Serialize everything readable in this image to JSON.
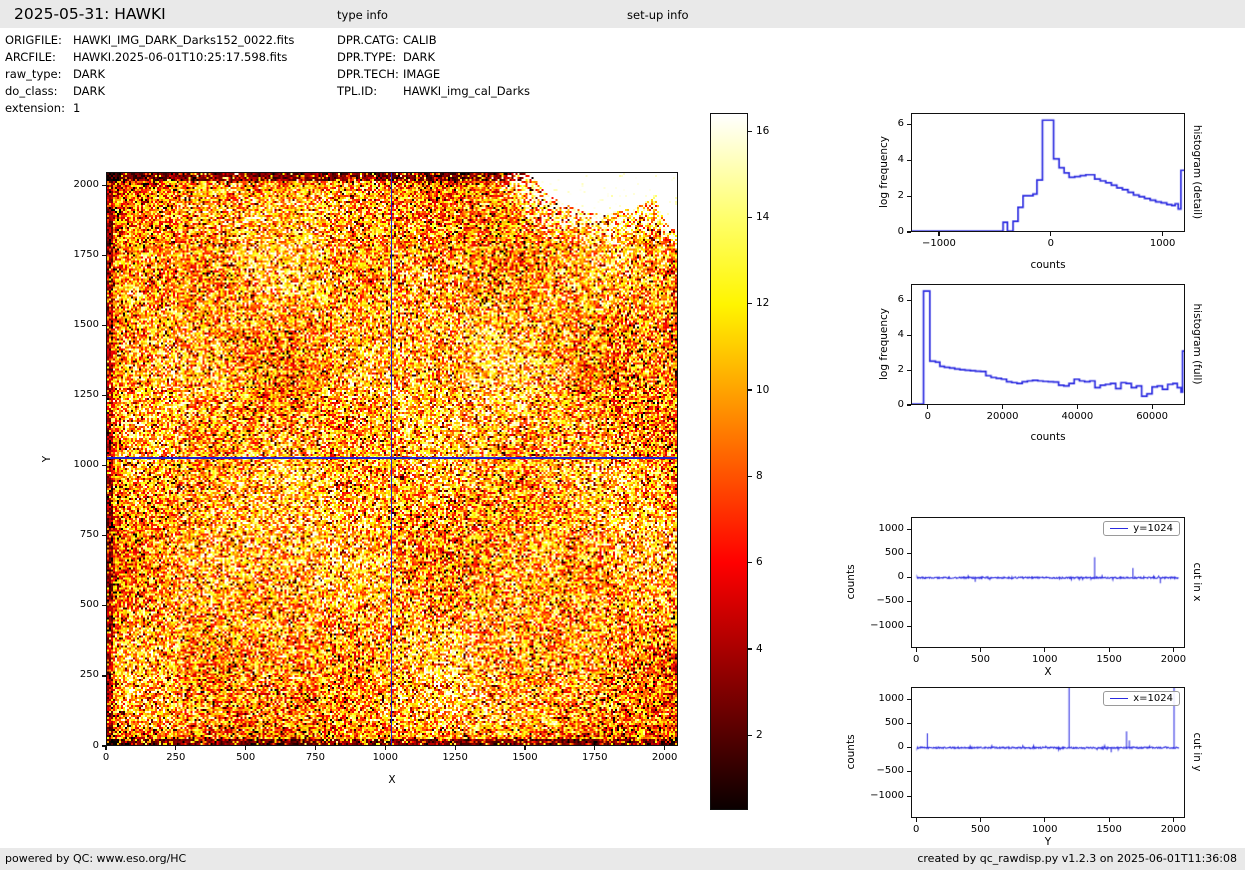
{
  "header": {
    "title": "2025-05-31: HAWKI",
    "type_info_label": "type info",
    "setup_info_label": "set-up info"
  },
  "file_info": {
    "rows": [
      {
        "key": "ORIGFILE:",
        "value": "HAWKI_IMG_DARK_Darks152_0022.fits"
      },
      {
        "key": "ARCFILE:",
        "value": "HAWKI.2025-06-01T10:25:17.598.fits"
      },
      {
        "key": "raw_type:",
        "value": "DARK"
      },
      {
        "key": "do_class:",
        "value": "DARK"
      },
      {
        "key": "extension:",
        "value": "1"
      }
    ]
  },
  "type_info": {
    "rows": [
      {
        "key": "DPR.CATG:",
        "value": "CALIB"
      },
      {
        "key": "DPR.TYPE:",
        "value": "DARK"
      },
      {
        "key": "DPR.TECH:",
        "value": "IMAGE"
      },
      {
        "key": "TPL.ID:",
        "value": "HAWKI_img_cal_Darks"
      }
    ]
  },
  "footer": {
    "left": "powered by QC: www.eso.org/HC",
    "right": "created by qc_rawdisp.py v1.2.3 on 2025-06-01T11:36:08"
  },
  "colors": {
    "accent_line": "#2a2ae0",
    "crosshair": "#2222cc",
    "bar_bg": "#e9e9e9",
    "axis": "#111111"
  },
  "chart_data": [
    {
      "type": "heatmap",
      "name": "raw dark frame display",
      "xlabel": "X",
      "ylabel": "Y",
      "xlim": [
        0,
        2048
      ],
      "ylim": [
        0,
        2048
      ],
      "xticks": [
        0,
        250,
        500,
        750,
        1000,
        1250,
        1500,
        1750,
        2000
      ],
      "yticks": [
        0,
        250,
        500,
        750,
        1000,
        1250,
        1500,
        1750,
        2000
      ],
      "colormap": "hot",
      "colorbar": {
        "ticks": [
          2,
          4,
          6,
          8,
          10,
          12,
          14,
          16
        ],
        "vmin": 0.27,
        "vmax": 16.42,
        "gradient_stops": [
          [
            0,
            "#0b0000"
          ],
          [
            0.107,
            "#550000"
          ],
          [
            0.231,
            "#aa0000"
          ],
          [
            0.355,
            "#ff0000"
          ],
          [
            0.479,
            "#ff5200"
          ],
          [
            0.602,
            "#ffa300"
          ],
          [
            0.726,
            "#fff500"
          ],
          [
            0.85,
            "#ffff6b"
          ],
          [
            0.974,
            "#ffffe5"
          ],
          [
            1,
            "#ffffff"
          ]
        ]
      },
      "crosshair": {
        "x": 1024,
        "y": 1024
      },
      "features": {
        "description": "2048x2048 speckle noise, counts mostly 5-15, dark bands at image edges, saturated white blob in top-right corner",
        "saturated_blobs": [
          {
            "cx": 1780,
            "cy": 2160,
            "rx": 290,
            "ry": 250
          },
          {
            "cx": 2090,
            "cy": 1990,
            "rx": 120,
            "ry": 160
          }
        ]
      }
    },
    {
      "type": "line",
      "variant": "step-histogram",
      "right_label": "histogram (detail)",
      "xlabel": "counts",
      "ylabel": "log frequency",
      "xlim": [
        -1250,
        1200
      ],
      "ylim": [
        0,
        6.65
      ],
      "xticks": [
        -1000,
        0,
        1000
      ],
      "yticks": [
        0,
        2,
        4,
        6
      ],
      "steps": [
        [
          -1250,
          0
        ],
        [
          -430,
          0.5
        ],
        [
          -390,
          0
        ],
        [
          -340,
          0.55
        ],
        [
          -295,
          1.35
        ],
        [
          -250,
          2.0
        ],
        [
          -205,
          2.0
        ],
        [
          -160,
          2.1
        ],
        [
          -125,
          2.9
        ],
        [
          -75,
          6.3
        ],
        [
          25,
          4.1
        ],
        [
          75,
          3.6
        ],
        [
          120,
          3.3
        ],
        [
          165,
          3.05
        ],
        [
          215,
          3.1
        ],
        [
          265,
          3.15
        ],
        [
          315,
          3.2
        ],
        [
          395,
          2.95
        ],
        [
          445,
          2.85
        ],
        [
          495,
          2.75
        ],
        [
          545,
          2.6
        ],
        [
          595,
          2.45
        ],
        [
          645,
          2.35
        ],
        [
          695,
          2.2
        ],
        [
          745,
          2.05
        ],
        [
          795,
          1.95
        ],
        [
          845,
          1.85
        ],
        [
          895,
          1.75
        ],
        [
          945,
          1.65
        ],
        [
          995,
          1.6
        ],
        [
          1045,
          1.5
        ],
        [
          1090,
          1.45
        ],
        [
          1120,
          1.55
        ],
        [
          1148,
          1.25
        ],
        [
          1172,
          3.45
        ],
        [
          1200,
          3.45
        ]
      ]
    },
    {
      "type": "line",
      "variant": "step-histogram",
      "right_label": "histogram (full)",
      "xlabel": "counts",
      "ylabel": "log frequency",
      "xlim": [
        -4500,
        68800
      ],
      "ylim": [
        0,
        6.95
      ],
      "xticks": [
        0,
        20000,
        40000,
        60000
      ],
      "yticks": [
        0,
        2,
        4,
        6
      ],
      "steps": [
        [
          -4500,
          0
        ],
        [
          -1400,
          6.6
        ],
        [
          300,
          2.5
        ],
        [
          1800,
          2.45
        ],
        [
          3000,
          2.2
        ],
        [
          4200,
          2.15
        ],
        [
          5600,
          2.1
        ],
        [
          7000,
          2.05
        ],
        [
          8400,
          2.0
        ],
        [
          9800,
          1.98
        ],
        [
          11200,
          1.95
        ],
        [
          12600,
          1.92
        ],
        [
          14000,
          1.9
        ],
        [
          15400,
          1.65
        ],
        [
          16800,
          1.55
        ],
        [
          18200,
          1.5
        ],
        [
          19600,
          1.45
        ],
        [
          21000,
          1.3
        ],
        [
          22400,
          1.25
        ],
        [
          23800,
          1.2
        ],
        [
          25200,
          1.3
        ],
        [
          26600,
          1.35
        ],
        [
          28000,
          1.38
        ],
        [
          29400,
          1.35
        ],
        [
          30800,
          1.32
        ],
        [
          32200,
          1.3
        ],
        [
          33600,
          1.28
        ],
        [
          35000,
          1.1
        ],
        [
          36400,
          1.05
        ],
        [
          37800,
          1.2
        ],
        [
          39200,
          1.45
        ],
        [
          40600,
          1.35
        ],
        [
          42000,
          1.3
        ],
        [
          43400,
          1.35
        ],
        [
          44800,
          0.95
        ],
        [
          46200,
          1.1
        ],
        [
          47600,
          1.15
        ],
        [
          49000,
          1.2
        ],
        [
          50400,
          0.9
        ],
        [
          51800,
          1.25
        ],
        [
          53200,
          1.2
        ],
        [
          54600,
          0.95
        ],
        [
          56000,
          1.05
        ],
        [
          57400,
          0.45
        ],
        [
          58800,
          0.6
        ],
        [
          60200,
          1.0
        ],
        [
          61600,
          1.05
        ],
        [
          63000,
          0.85
        ],
        [
          64400,
          1.15
        ],
        [
          65800,
          1.2
        ],
        [
          67000,
          0.95
        ],
        [
          68000,
          0.7
        ],
        [
          68400,
          3.1
        ],
        [
          68800,
          3.1
        ]
      ]
    },
    {
      "type": "line",
      "variant": "profile-cut",
      "legend": "y=1024",
      "right_label": "cut in x",
      "xlabel": "X",
      "ylabel": "counts",
      "xlim": [
        -40,
        2090
      ],
      "ylim": [
        -1450,
        1250
      ],
      "xticks": [
        0,
        500,
        1000,
        1500,
        2000
      ],
      "yticks": [
        -1000,
        -500,
        0,
        500,
        1000
      ],
      "noise_amp": 16,
      "spikes": [
        {
          "x": 455,
          "v": -85
        },
        {
          "x": 1390,
          "v": 430
        },
        {
          "x": 1690,
          "v": 205
        },
        {
          "x": 1905,
          "v": -115
        }
      ]
    },
    {
      "type": "line",
      "variant": "profile-cut",
      "legend": "x=1024",
      "right_label": "cut in y",
      "xlabel": "Y",
      "ylabel": "counts",
      "xlim": [
        -40,
        2090
      ],
      "ylim": [
        -1450,
        1250
      ],
      "xticks": [
        0,
        500,
        1000,
        1500,
        2000
      ],
      "yticks": [
        -1000,
        -500,
        0,
        500,
        1000
      ],
      "noise_amp": 16,
      "spikes": [
        {
          "x": 80,
          "v": 300
        },
        {
          "x": 1190,
          "v": 2600
        },
        {
          "x": 1520,
          "v": -95
        },
        {
          "x": 1640,
          "v": 345
        },
        {
          "x": 1662,
          "v": 150
        },
        {
          "x": 2012,
          "v": 2600
        }
      ]
    }
  ]
}
